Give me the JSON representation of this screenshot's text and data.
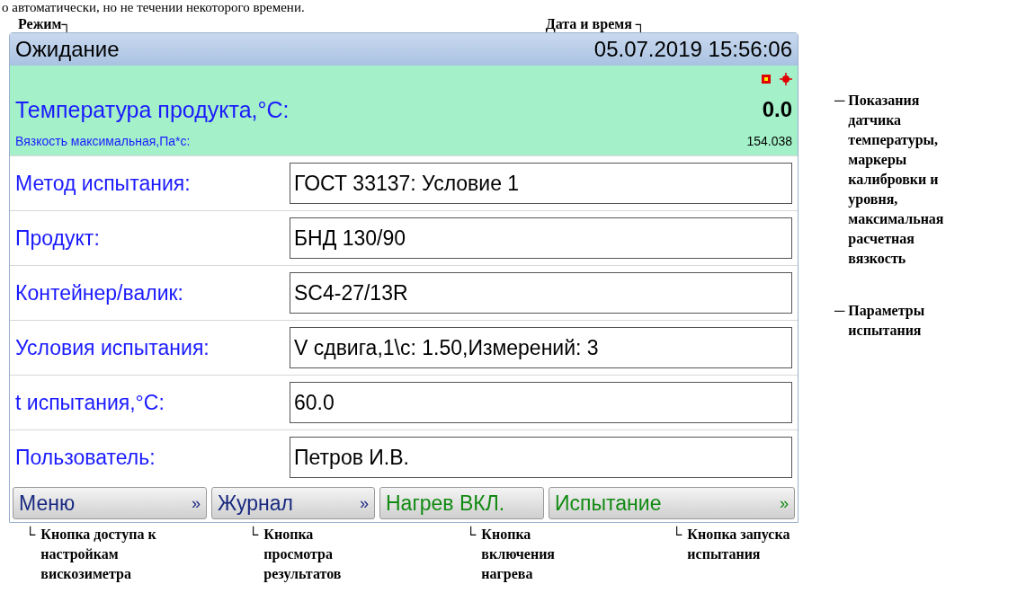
{
  "top_text": "о автоматически, но не течении некоторого времени.",
  "callouts_top": [
    "Режим┐",
    "Дата и время ┐"
  ],
  "screen": {
    "mode": "Ожидание",
    "datetime": "05.07.2019 15:56:06",
    "sensor": {
      "label": "Температура продукта,°C:",
      "value": "0.0",
      "viscosity_label": "Вязкость максимальная,Па*с:",
      "viscosity_value": "154.038"
    },
    "params": [
      {
        "label": "Метод испытания:",
        "value": "ГОСТ 33137: Условие 1"
      },
      {
        "label": "Продукт:",
        "value": "БНД 130/90"
      },
      {
        "label": "Контейнер/валик:",
        "value": "SC4-27/13R"
      },
      {
        "label": "Условия испытания:",
        "value": "V сдвига,1\\с: 1.50,Измерений: 3"
      },
      {
        "label": "t испытания,°C:",
        "value": "60.0"
      },
      {
        "label": "Пользователь:",
        "value": "Петров И.В."
      }
    ],
    "buttons": [
      {
        "label": "Меню",
        "arrow": "»",
        "color": "#1a2a80"
      },
      {
        "label": "Журнал",
        "arrow": "»",
        "color": "#1a2a80"
      },
      {
        "label": "Нагрев ВКЛ.",
        "color": "#118a11"
      },
      {
        "label": "Испытание",
        "arrow": "»",
        "color": "#118a11"
      }
    ]
  },
  "callouts_right": [
    {
      "mark": "─",
      "text": "Показания датчика температуры, маркеры калибровки и уровня, максимальная расчетная вязкость"
    },
    {
      "mark": "─",
      "text": "Параметры испытания"
    }
  ],
  "callouts_bottom": [
    {
      "mark": "└",
      "text": "Кнопка доступа к настройкам вискозиметра"
    },
    {
      "mark": "└",
      "text": "Кнопка просмотра результатов"
    },
    {
      "mark": "└",
      "text": "Кнопка включения нагрева"
    },
    {
      "mark": "└",
      "text": "Кнопка запуска испытания"
    }
  ]
}
